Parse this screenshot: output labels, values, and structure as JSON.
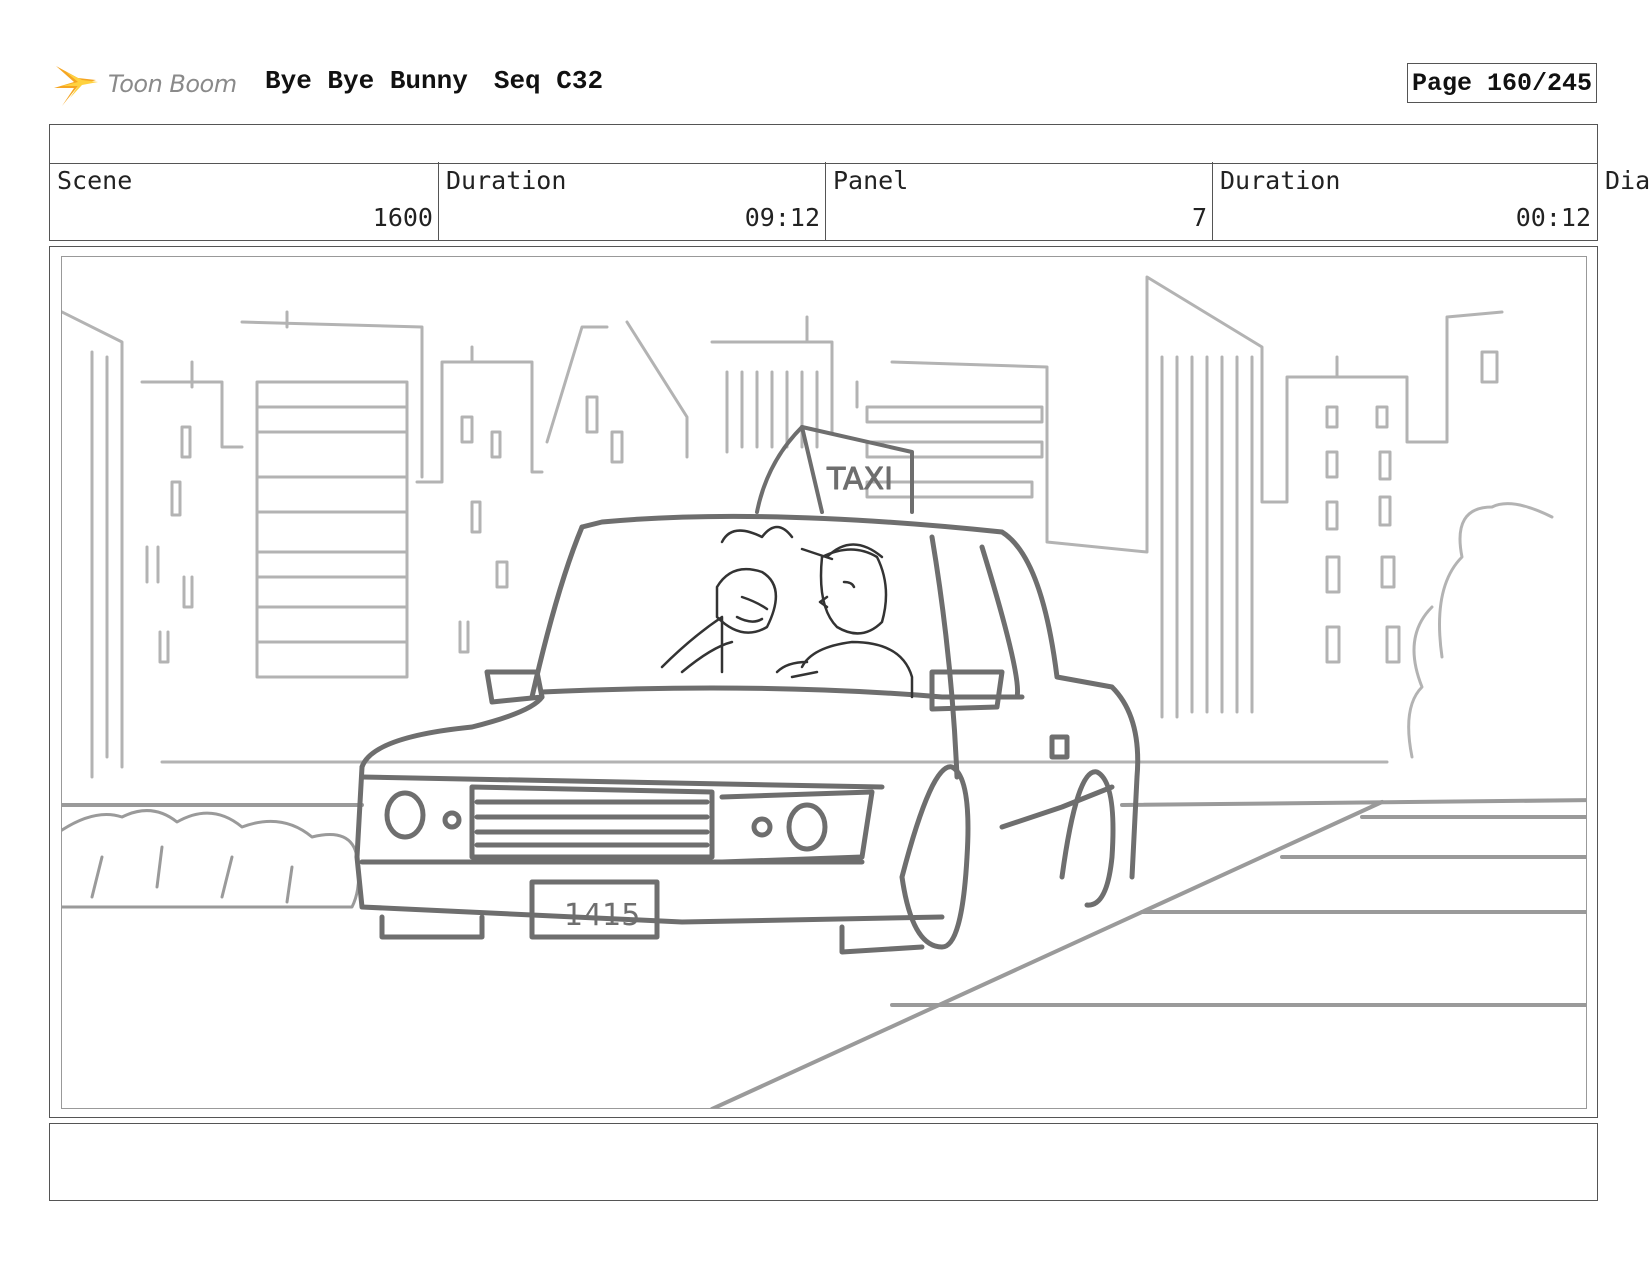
{
  "header": {
    "logo_text": "Toon Boom",
    "project_title": "Bye Bye Bunny",
    "sequence": "Seq C32",
    "page": "Page 160/245"
  },
  "info": {
    "scene_label": "Scene",
    "scene_value": "1600",
    "scene_duration_label": "Duration",
    "scene_duration_value": "09:12",
    "panel_label": "Panel",
    "panel_value": "7",
    "panel_duration_label": "Duration",
    "panel_duration_value": "00:12",
    "overflow_label": "Dia"
  },
  "panel": {
    "taxi_sign": "TAXI",
    "license_plate": "1415"
  },
  "colors": {
    "logo_orange": "#f5a623",
    "logo_yellow": "#ffd23f",
    "sketch_dark": "#6e6e6e",
    "sketch_light": "#b3b3b3"
  }
}
